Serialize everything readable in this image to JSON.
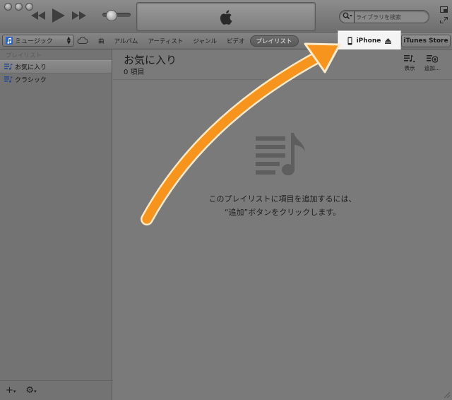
{
  "toolbar": {
    "search": {
      "placeholder": "ライブラリを検索"
    }
  },
  "sourcebar": {
    "library_selector": "ミュージック",
    "tabs": [
      "曲",
      "アルバム",
      "アーティスト",
      "ジャンル",
      "ビデオ",
      "プレイリスト"
    ],
    "active_tab": "プレイリスト",
    "device": "iPhone",
    "store": "iTunes Store"
  },
  "sidebar": {
    "section_header": "プレイリスト",
    "items": [
      {
        "label": "お気に入り",
        "selected": true
      },
      {
        "label": "クラシック",
        "selected": false
      }
    ]
  },
  "main": {
    "title": "お気に入り",
    "count": "0 項目",
    "view_button": "表示",
    "add_button": "追加...",
    "empty_line1": "このプレイリストに項目を追加するには、",
    "empty_line2": "“追加”ボタンをクリックします。"
  },
  "colors": {
    "annotation_arrow": "#f7941d",
    "arrow_outline": "#fbe9c8"
  }
}
